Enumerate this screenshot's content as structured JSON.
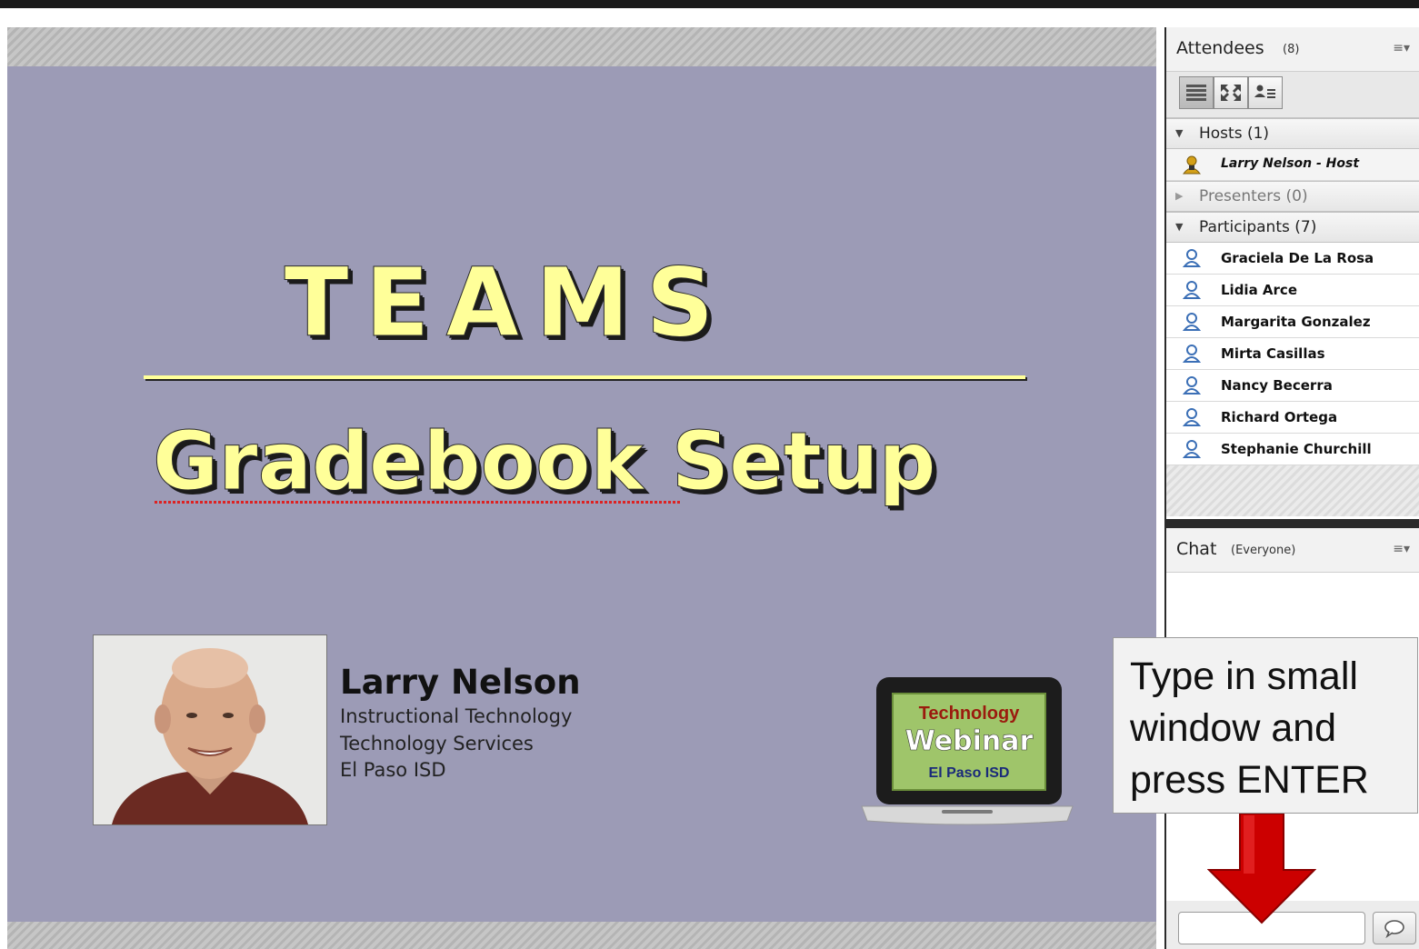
{
  "slide": {
    "title": "TEAMS",
    "subtitle": "Gradebook  Setup",
    "presenter": {
      "name": "Larry Nelson",
      "lines": [
        "Instructional Technology",
        "Technology Services",
        "El Paso ISD"
      ]
    },
    "logo": {
      "line1": "Technology",
      "line2": "Webinar",
      "line3": "El Paso ISD"
    }
  },
  "attendees": {
    "title": "Attendees",
    "count": "(8)",
    "menu_icon": "menu-icon",
    "groups": {
      "hosts": {
        "label": "Hosts (1)",
        "members": [
          "Larry Nelson - Host"
        ]
      },
      "presenters": {
        "label": "Presenters (0)"
      },
      "participants": {
        "label": "Participants (7)",
        "members": [
          "Graciela De La Rosa",
          "Lidia Arce",
          "Margarita Gonzalez",
          "Mirta Casillas",
          "Nancy Becerra",
          "Richard Ortega",
          "Stephanie Churchill"
        ]
      }
    }
  },
  "chat": {
    "title": "Chat",
    "scope": "(Everyone)",
    "input_value": ""
  },
  "callout": {
    "lines": [
      "Type in small",
      "window and",
      "press ENTER"
    ]
  },
  "colors": {
    "slide_bg": "#9c9bb6",
    "title_yellow": "#ffff99",
    "arrow_red": "#cc0000",
    "host_icon": "#d4a017",
    "participant_icon": "#3b6fb6"
  }
}
